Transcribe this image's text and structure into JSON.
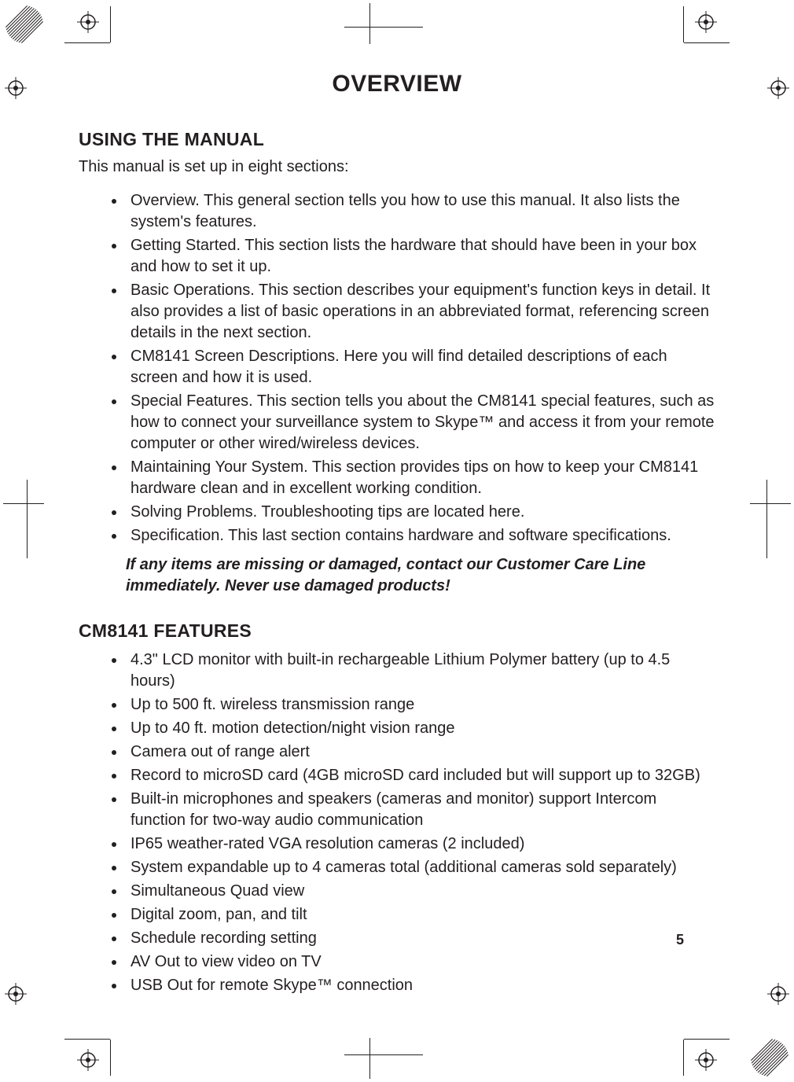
{
  "title": "OVERVIEW",
  "section1": {
    "heading": "USING THE MANUAL",
    "intro": "This manual is set up in eight sections:",
    "items": [
      "Overview. This general section tells you how to use this manual. It also lists the system's features.",
      "Getting Started. This section lists the hardware that should have been in your box and how to set it up.",
      "Basic Operations. This section describes your equipment's function keys in detail. It also provides a list of basic operations in an abbreviated format, referencing screen details in the next section.",
      "CM8141  Screen Descriptions. Here you will find detailed descriptions of each screen and how it is used.",
      "Special Features. This section tells you about the CM8141 special features, such as how to connect your surveillance system to Skype™ and access it from your remote computer or other wired/wireless devices.",
      "Maintaining Your System. This section provides tips on how to keep your CM8141 hardware clean and in excellent working condition.",
      "Solving Problems. Troubleshooting tips are located here.",
      "Specification. This last section contains hardware and software specifications."
    ],
    "note": "If any items are missing or damaged, contact our Customer Care Line immediately. Never use damaged products!"
  },
  "section2": {
    "heading": "CM8141 FEATURES",
    "items": [
      "4.3\" LCD monitor with built-in rechargeable Lithium Polymer battery (up to 4.5 hours)",
      "Up to 500 ft. wireless transmission range",
      "Up to 40 ft. motion detection/night vision range",
      "Camera out of range alert",
      "Record to microSD card (4GB microSD card included but will support up to 32GB)",
      "Built-in microphones and speakers (cameras and monitor) support Intercom function for two-way audio communication",
      "IP65 weather-rated VGA resolution cameras (2 included)",
      "System expandable up to 4 cameras total (additional cameras sold separately)",
      "Simultaneous Quad view",
      "Digital zoom, pan, and tilt",
      "Schedule recording setting",
      "AV Out to view video on TV",
      "USB Out for remote Skype™ connection"
    ]
  },
  "pageNumber": "5"
}
